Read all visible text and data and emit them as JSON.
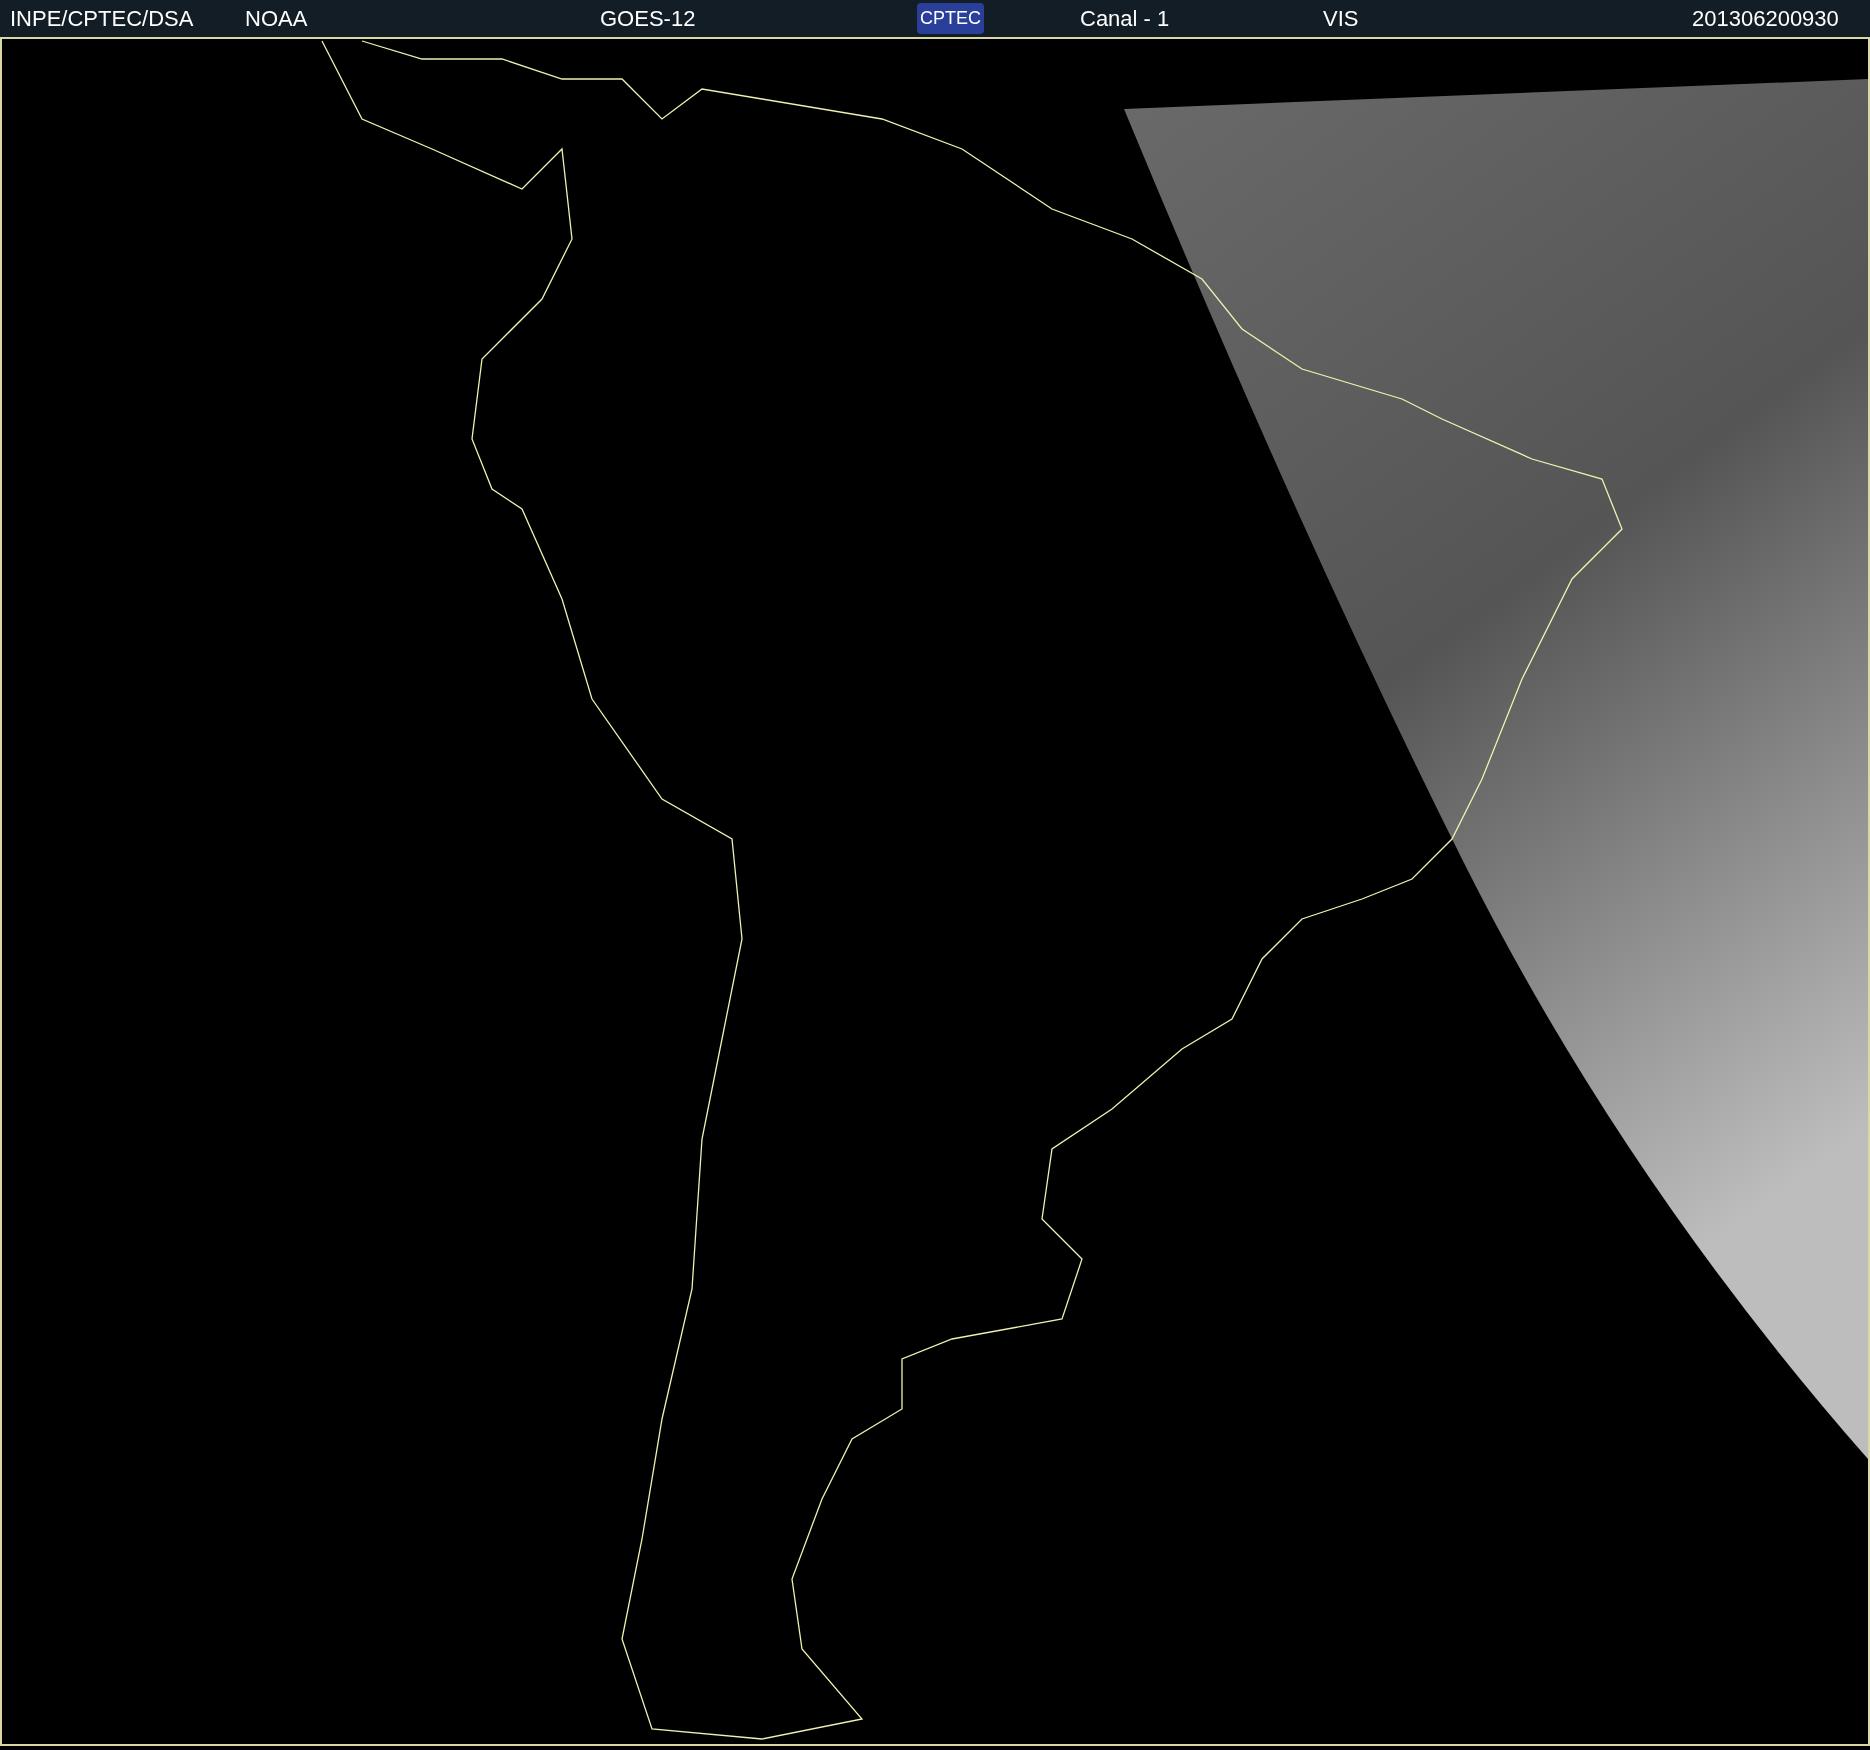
{
  "header": {
    "items": [
      {
        "kind": "text",
        "text": "INPE/CPTEC/DSA"
      },
      {
        "kind": "text",
        "text": "NOAA"
      },
      {
        "kind": "text",
        "text": "GOES-12"
      },
      {
        "kind": "logo",
        "text": "CPTEC"
      },
      {
        "kind": "text",
        "text": "Canal - 1"
      },
      {
        "kind": "text",
        "text": "VIS"
      },
      {
        "kind": "text",
        "text": "201306200930"
      }
    ]
  }
}
